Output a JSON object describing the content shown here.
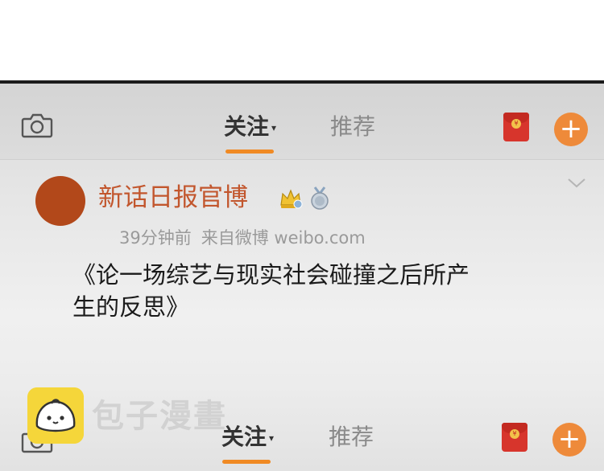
{
  "header": {
    "tab_follow": "关注",
    "tab_recommend": "推荐",
    "caret": "▾",
    "plus": "+"
  },
  "post": {
    "username": "新话日报官博",
    "time": "39分钟前",
    "source": "来自微博 weibo.com",
    "text": "《论一场综艺与现实社会碰撞之后所产生的反思》",
    "badges": [
      "crown-badge-icon",
      "medal-badge-icon"
    ]
  },
  "bottom_nav": {
    "tab_follow": "关注",
    "tab_recommend": "推荐",
    "caret": "▾",
    "plus": "+"
  },
  "watermark": {
    "text": "包子漫畫"
  },
  "colors": {
    "accent": "#f08a24",
    "username": "#c2562d",
    "avatar": "#b2481a",
    "redpacket": "#d7352c"
  }
}
